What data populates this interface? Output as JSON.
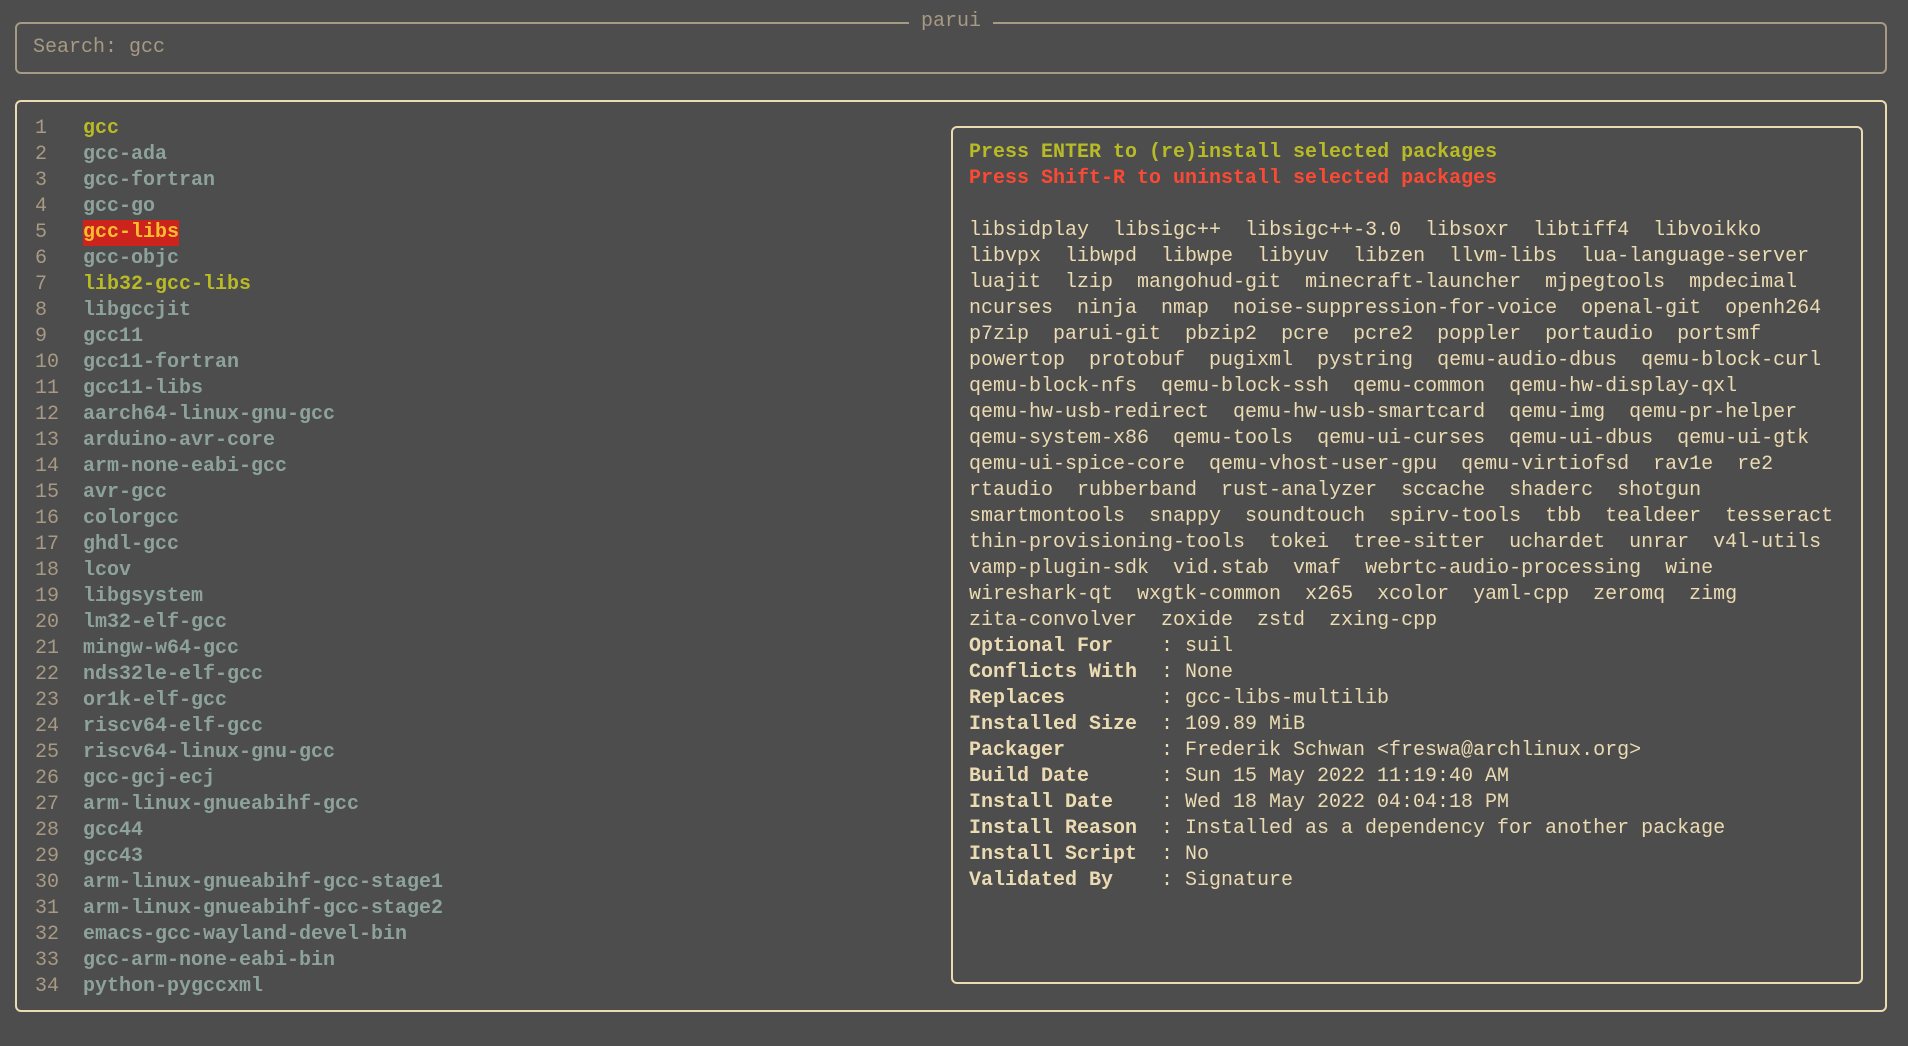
{
  "app_title": "parui",
  "search": {
    "text": "Search: gcc"
  },
  "colors": {
    "background": "#4d4d4d",
    "installed": "#b8bb26",
    "not_installed": "#83a598",
    "selected_bg": "#cc241d",
    "selected_fg": "#fabd2f",
    "uninstall_hint": "#fb4934",
    "text": "#ebdbb2"
  },
  "packages": [
    {
      "n": "1",
      "name": "gcc",
      "state": "installed"
    },
    {
      "n": "2",
      "name": "gcc-ada",
      "state": ""
    },
    {
      "n": "3",
      "name": "gcc-fortran",
      "state": ""
    },
    {
      "n": "4",
      "name": "gcc-go",
      "state": ""
    },
    {
      "n": "5",
      "name": "gcc-libs",
      "state": "selected"
    },
    {
      "n": "6",
      "name": "gcc-objc",
      "state": ""
    },
    {
      "n": "7",
      "name": "lib32-gcc-libs",
      "state": "installed"
    },
    {
      "n": "8",
      "name": "libgccjit",
      "state": ""
    },
    {
      "n": "9",
      "name": "gcc11",
      "state": ""
    },
    {
      "n": "10",
      "name": "gcc11-fortran",
      "state": ""
    },
    {
      "n": "11",
      "name": "gcc11-libs",
      "state": ""
    },
    {
      "n": "12",
      "name": "aarch64-linux-gnu-gcc",
      "state": ""
    },
    {
      "n": "13",
      "name": "arduino-avr-core",
      "state": ""
    },
    {
      "n": "14",
      "name": "arm-none-eabi-gcc",
      "state": ""
    },
    {
      "n": "15",
      "name": "avr-gcc",
      "state": ""
    },
    {
      "n": "16",
      "name": "colorgcc",
      "state": ""
    },
    {
      "n": "17",
      "name": "ghdl-gcc",
      "state": ""
    },
    {
      "n": "18",
      "name": "lcov",
      "state": ""
    },
    {
      "n": "19",
      "name": "libgsystem",
      "state": ""
    },
    {
      "n": "20",
      "name": "lm32-elf-gcc",
      "state": ""
    },
    {
      "n": "21",
      "name": "mingw-w64-gcc",
      "state": ""
    },
    {
      "n": "22",
      "name": "nds32le-elf-gcc",
      "state": ""
    },
    {
      "n": "23",
      "name": "or1k-elf-gcc",
      "state": ""
    },
    {
      "n": "24",
      "name": "riscv64-elf-gcc",
      "state": ""
    },
    {
      "n": "25",
      "name": "riscv64-linux-gnu-gcc",
      "state": ""
    },
    {
      "n": "26",
      "name": "gcc-gcj-ecj",
      "state": ""
    },
    {
      "n": "27",
      "name": "arm-linux-gnueabihf-gcc",
      "state": ""
    },
    {
      "n": "28",
      "name": "gcc44",
      "state": ""
    },
    {
      "n": "29",
      "name": "gcc43",
      "state": ""
    },
    {
      "n": "30",
      "name": "arm-linux-gnueabihf-gcc-stage1",
      "state": ""
    },
    {
      "n": "31",
      "name": "arm-linux-gnueabihf-gcc-stage2",
      "state": ""
    },
    {
      "n": "32",
      "name": "emacs-gcc-wayland-devel-bin",
      "state": ""
    },
    {
      "n": "33",
      "name": "gcc-arm-none-eabi-bin",
      "state": ""
    },
    {
      "n": "34",
      "name": "python-pygccxml",
      "state": ""
    }
  ],
  "detail": {
    "hint_install": "Press ENTER to (re)install selected packages",
    "hint_uninstall": "Press Shift-R to uninstall selected packages",
    "required_by": [
      "libsidplay",
      "libsigc++",
      "libsigc++-3.0",
      "libsoxr",
      "libtiff4",
      "libvoikko",
      "libvpx",
      "libwpd",
      "libwpe",
      "libyuv",
      "libzen",
      "llvm-libs",
      "lua-language-server",
      "luajit",
      "lzip",
      "mangohud-git",
      "minecraft-launcher",
      "mjpegtools",
      "mpdecimal",
      "ncurses",
      "ninja",
      "nmap",
      "noise-suppression-for-voice",
      "openal-git",
      "openh264",
      "p7zip",
      "parui-git",
      "pbzip2",
      "pcre",
      "pcre2",
      "poppler",
      "portaudio",
      "portsmf",
      "powertop",
      "protobuf",
      "pugixml",
      "pystring",
      "qemu-audio-dbus",
      "qemu-block-curl",
      "qemu-block-nfs",
      "qemu-block-ssh",
      "qemu-common",
      "qemu-hw-display-qxl",
      "qemu-hw-usb-redirect",
      "qemu-hw-usb-smartcard",
      "qemu-img",
      "qemu-pr-helper",
      "qemu-system-x86",
      "qemu-tools",
      "qemu-ui-curses",
      "qemu-ui-dbus",
      "qemu-ui-gtk",
      "qemu-ui-spice-core",
      "qemu-vhost-user-gpu",
      "qemu-virtiofsd",
      "rav1e",
      "re2",
      "rtaudio",
      "rubberband",
      "rust-analyzer",
      "sccache",
      "shaderc",
      "shotgun",
      "smartmontools",
      "snappy",
      "soundtouch",
      "spirv-tools",
      "tbb",
      "tealdeer",
      "tesseract",
      "thin-provisioning-tools",
      "tokei",
      "tree-sitter",
      "uchardet",
      "unrar",
      "v4l-utils",
      "vamp-plugin-sdk",
      "vid.stab",
      "vmaf",
      "webrtc-audio-processing",
      "wine",
      "wireshark-qt",
      "wxgtk-common",
      "x265",
      "xcolor",
      "yaml-cpp",
      "zeromq",
      "zimg",
      "zita-convolver",
      "zoxide",
      "zstd",
      "zxing-cpp"
    ],
    "fields": [
      {
        "key": "Optional For",
        "value": "suil"
      },
      {
        "key": "Conflicts With",
        "value": "None"
      },
      {
        "key": "Replaces",
        "value": "gcc-libs-multilib"
      },
      {
        "key": "Installed Size",
        "value": "109.89 MiB"
      },
      {
        "key": "Packager",
        "value": "Frederik Schwan <freswa@archlinux.org>"
      },
      {
        "key": "Build Date",
        "value": "Sun 15 May 2022 11:19:40 AM"
      },
      {
        "key": "Install Date",
        "value": "Wed 18 May 2022 04:04:18 PM"
      },
      {
        "key": "Install Reason",
        "value": "Installed as a dependency for another package"
      },
      {
        "key": "Install Script",
        "value": "No"
      },
      {
        "key": "Validated By",
        "value": "Signature"
      }
    ],
    "separator": ":"
  }
}
